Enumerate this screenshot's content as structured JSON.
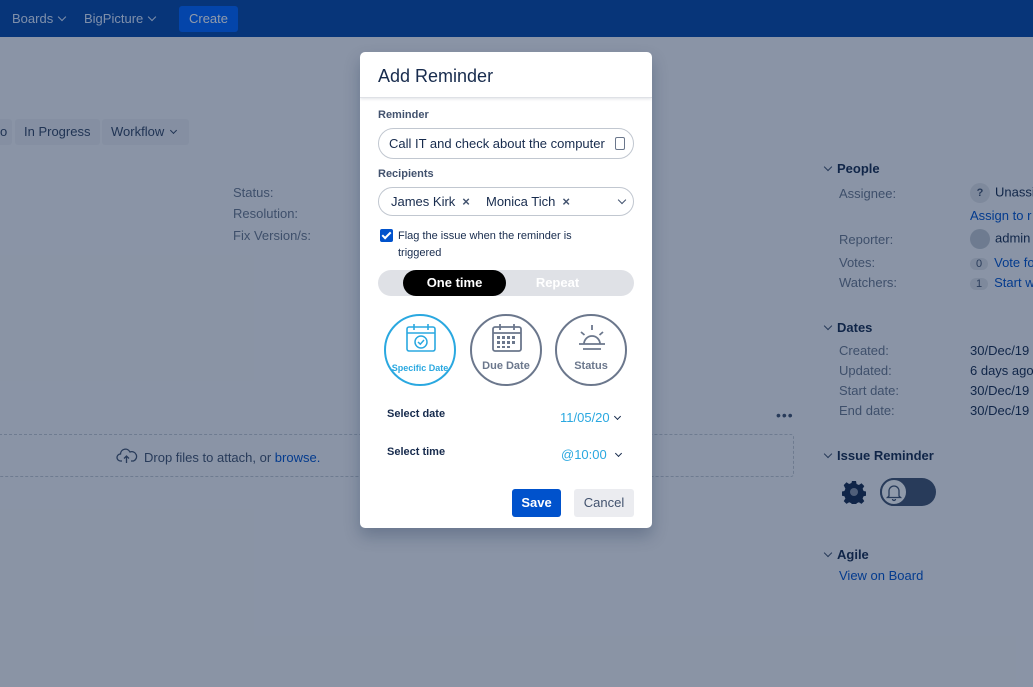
{
  "topnav": {
    "items": [
      {
        "label": "Boards"
      },
      {
        "label": "BigPicture"
      }
    ],
    "create_label": "Create"
  },
  "issue": {
    "workflow_buttons": [
      {
        "label": "o"
      },
      {
        "label": "In Progress"
      },
      {
        "label": "Workflow"
      }
    ],
    "details": {
      "status_label": "Status:",
      "resolution_label": "Resolution:",
      "fix_version_label": "Fix Version/s:"
    },
    "attachments": {
      "drop_text": "Drop files to attach, or ",
      "browse_link": "browse.",
      "more": "•••"
    }
  },
  "sidebar": {
    "people": {
      "title": "People",
      "assignee_label": "Assignee:",
      "assignee_value": "Unassi",
      "assign_link": "Assign to r",
      "reporter_label": "Reporter:",
      "reporter_value": "admin",
      "votes_label": "Votes:",
      "votes_count": "0",
      "votes_link": "Vote fo",
      "watchers_label": "Watchers:",
      "watchers_count": "1",
      "watchers_link": "Start w"
    },
    "dates": {
      "title": "Dates",
      "created_label": "Created:",
      "created_value": "30/Dec/19",
      "updated_label": "Updated:",
      "updated_value": "6 days ago",
      "start_label": "Start date:",
      "start_value": "30/Dec/19",
      "end_label": "End date:",
      "end_value": "30/Dec/19"
    },
    "issue_reminder": {
      "title": "Issue Reminder",
      "toggle_on": false
    },
    "agile": {
      "title": "Agile",
      "link": "View on Board"
    }
  },
  "modal": {
    "title": "Add Reminder",
    "reminder_label": "Reminder",
    "reminder_value": "Call IT and check about the computer",
    "recipients_label": "Recipients",
    "recipients": [
      {
        "name": "James Kirk"
      },
      {
        "name": "Monica Tich"
      }
    ],
    "remove_glyph": "×",
    "flag_checked": true,
    "flag_text": "Flag the issue when the reminder is triggered",
    "mode_active": "One time",
    "mode_inactive": "Repeat",
    "options": [
      {
        "label": "Specific Date",
        "selected": true
      },
      {
        "label": "Due Date",
        "selected": false
      },
      {
        "label": "Status",
        "selected": false
      }
    ],
    "select_date_label": "Select date",
    "select_date_value": "11/05/20",
    "select_time_label": "Select time",
    "select_time_value": "@10:00",
    "save_label": "Save",
    "cancel_label": "Cancel"
  },
  "colors": {
    "nav": "#0747a6",
    "primary": "#0052cc",
    "accent": "#2aa8e0"
  }
}
